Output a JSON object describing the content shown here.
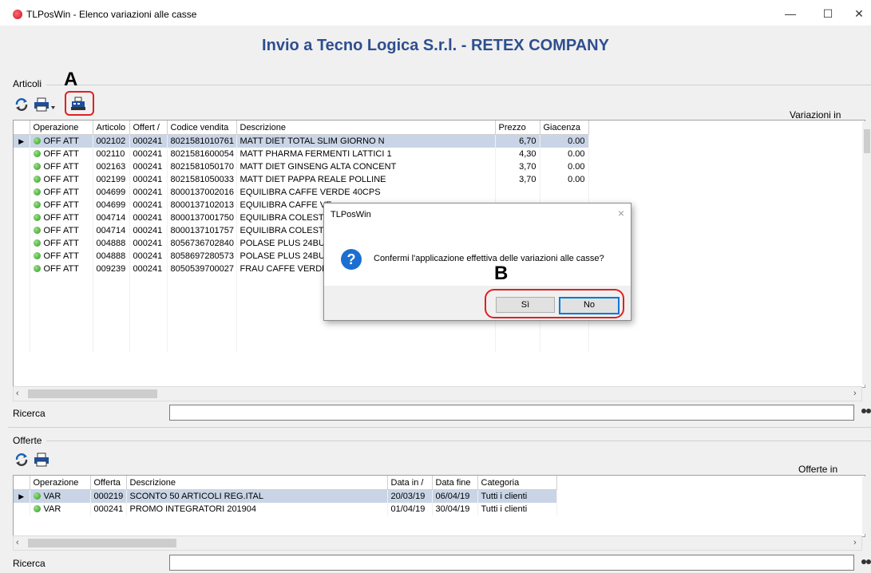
{
  "window": {
    "title": "TLPosWin - Elenco variazioni alle casse",
    "minimize": "—",
    "maximize": "☐",
    "close": "✕"
  },
  "header": {
    "title": "Invio a Tecno Logica S.r.l. - RETEX COMPANY"
  },
  "annotations": {
    "a": "A",
    "b": "B"
  },
  "articoli": {
    "label": "Articoli",
    "right_label": "Variazioni in elenco:",
    "columns": [
      "Operazione",
      "Articolo",
      "Offert /",
      "Codice vendita",
      "Descrizione",
      "Prezzo",
      "Giacenza"
    ],
    "rows": [
      {
        "op": "OFF ATT",
        "art": "002102",
        "off": "000241",
        "cod": "8021581010761",
        "desc": "MATT DIET TOTAL SLIM GIORNO N",
        "prezzo": "6,70",
        "giac": "0.00"
      },
      {
        "op": "OFF ATT",
        "art": "002110",
        "off": "000241",
        "cod": "8021581600054",
        "desc": "MATT PHARMA FERMENTI LATTICI 1",
        "prezzo": "4,30",
        "giac": "0.00"
      },
      {
        "op": "OFF ATT",
        "art": "002163",
        "off": "000241",
        "cod": "8021581050170",
        "desc": "MATT DIET GINSENG ALTA CONCENT",
        "prezzo": "3,70",
        "giac": "0.00"
      },
      {
        "op": "OFF ATT",
        "art": "002199",
        "off": "000241",
        "cod": "8021581050033",
        "desc": "MATT DIET PAPPA REALE POLLINE",
        "prezzo": "3,70",
        "giac": "0.00"
      },
      {
        "op": "OFF ATT",
        "art": "004699",
        "off": "000241",
        "cod": "8000137002016",
        "desc": "EQUILIBRA CAFFE  VERDE 40CPS",
        "prezzo": "",
        "giac": ""
      },
      {
        "op": "OFF ATT",
        "art": "004699",
        "off": "000241",
        "cod": "8000137102013",
        "desc": "EQUILIBRA CAFFE  VE",
        "prezzo": "",
        "giac": ""
      },
      {
        "op": "OFF ATT",
        "art": "004714",
        "off": "000241",
        "cod": "8000137001750",
        "desc": "EQUILIBRA COLEST-C",
        "prezzo": "",
        "giac": ""
      },
      {
        "op": "OFF ATT",
        "art": "004714",
        "off": "000241",
        "cod": "8000137101757",
        "desc": "EQUILIBRA COLEST-C",
        "prezzo": "",
        "giac": ""
      },
      {
        "op": "OFF ATT",
        "art": "004888",
        "off": "000241",
        "cod": "8056736702840",
        "desc": "POLASE PLUS 24BUS",
        "prezzo": "",
        "giac": ""
      },
      {
        "op": "OFF ATT",
        "art": "004888",
        "off": "000241",
        "cod": "8058697280573",
        "desc": "POLASE PLUS 24BUS",
        "prezzo": "",
        "giac": ""
      },
      {
        "op": "OFF ATT",
        "art": "009239",
        "off": "000241",
        "cod": "8050539700027",
        "desc": "FRAU CAFFE  VERDE",
        "prezzo": "",
        "giac": ""
      }
    ],
    "search_label": "Ricerca",
    "search_value": ""
  },
  "offerte": {
    "label": "Offerte",
    "right_label": "Offerte in elenco:",
    "columns": [
      "Operazione",
      "Offerta",
      "Descrizione",
      "Data in /",
      "Data fine",
      "Categoria"
    ],
    "rows": [
      {
        "op": "VAR",
        "off": "000219",
        "desc": "SCONTO 50 ARTICOLI REG.ITAL",
        "din": "20/03/19",
        "dfine": "06/04/19",
        "cat": "Tutti i clienti"
      },
      {
        "op": "VAR",
        "off": "000241",
        "desc": "PROMO INTEGRATORI 201904",
        "din": "01/04/19",
        "dfine": "30/04/19",
        "cat": "Tutti i clienti"
      }
    ],
    "search_label": "Ricerca",
    "search_value": ""
  },
  "dialog": {
    "title": "TLPosWin",
    "message": "Confermi l'applicazione effettiva delle variazioni alle casse?",
    "yes_label": "Sì",
    "no_label": "No",
    "icon": "question-icon"
  },
  "colors": {
    "header_text": "#2e4f8f",
    "selected_row": "#c9d5e6",
    "annotation": "#e02020",
    "status_dot": "#2e9a1e"
  }
}
